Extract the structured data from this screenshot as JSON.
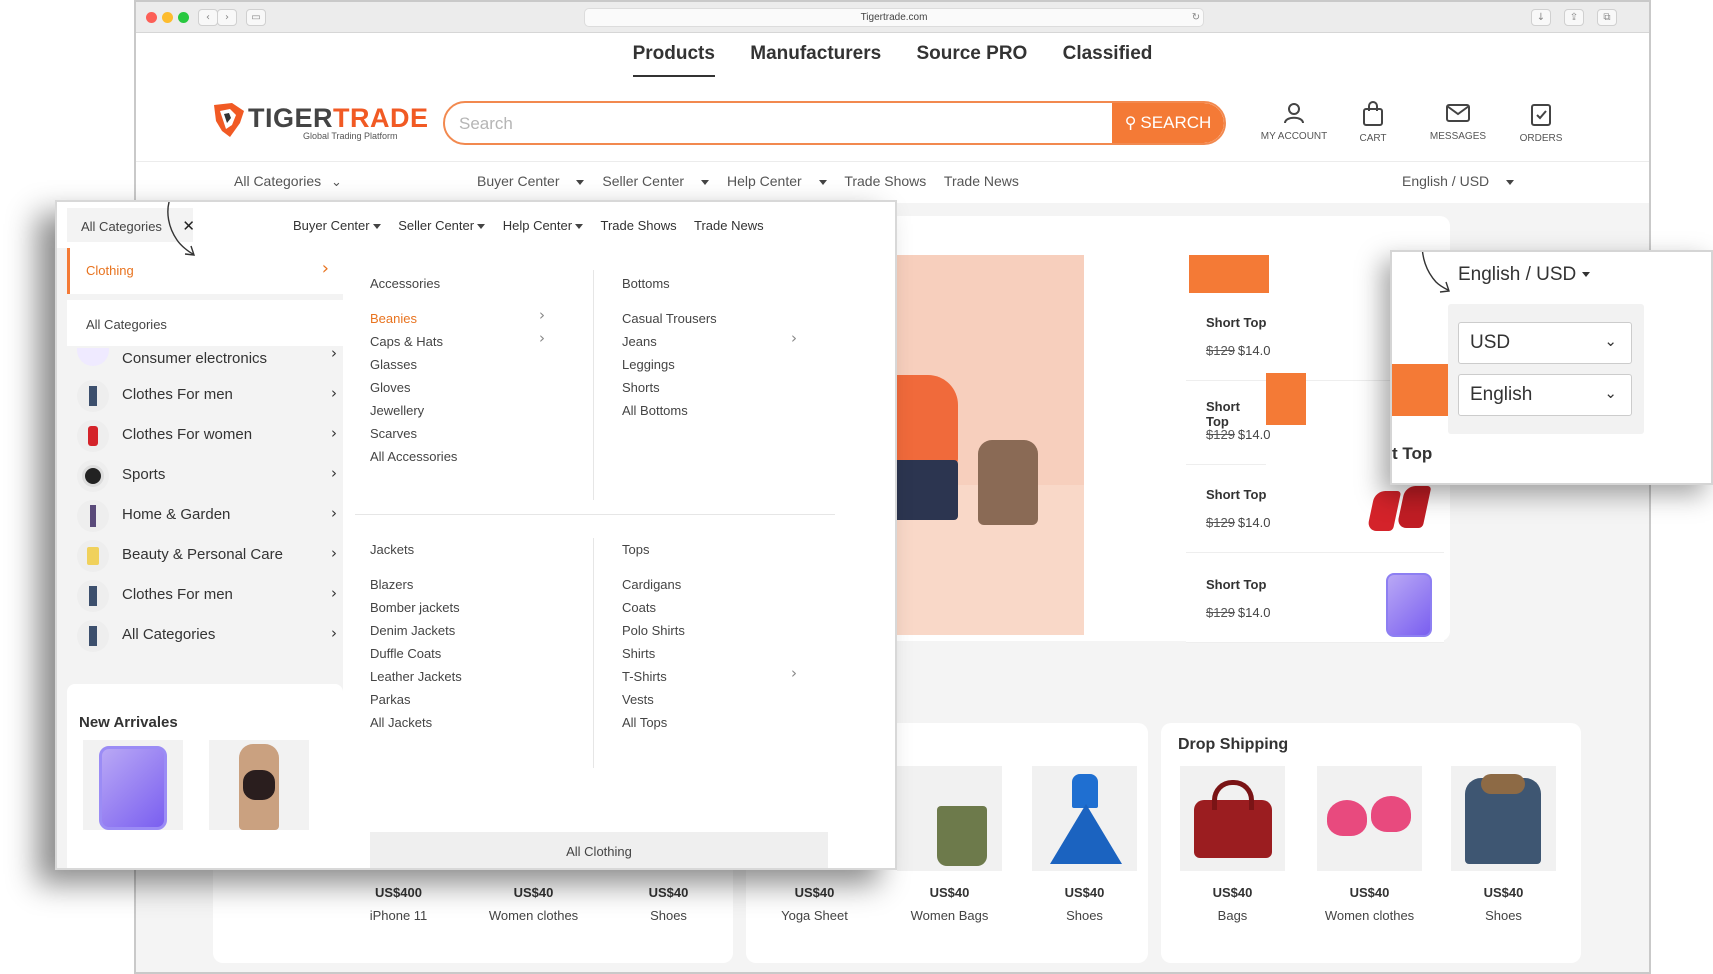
{
  "browser": {
    "url": "Tigertrade.com"
  },
  "topnav": {
    "items": [
      "Products",
      "Manufacturers",
      "Source PRO",
      "Classified"
    ]
  },
  "logo": {
    "name_a": "TIGER",
    "name_b": "TRADE",
    "tagline": "Global Trading Platform"
  },
  "search": {
    "placeholder": "Search",
    "button": "SEARCH"
  },
  "header_icons": {
    "account": "MY ACCOUNT",
    "cart": "CART",
    "messages": "MESSAGES",
    "orders": "ORDERS"
  },
  "subnav": {
    "all_categories": "All Categories",
    "buyer": "Buyer Center",
    "seller": "Seller Center",
    "help": "Help Center",
    "shows": "Trade Shows",
    "news": "Trade News",
    "lang": "English / USD"
  },
  "side_products": [
    {
      "title": "Short Top",
      "old": "$129",
      "new": "$14.0"
    },
    {
      "title": "Short Top",
      "old": "$129",
      "new": "$14.0"
    },
    {
      "title": "Short Top",
      "old": "$129",
      "new": "$14.0"
    },
    {
      "title": "Short Top",
      "old": "$129",
      "new": "$14.0"
    }
  ],
  "side_partial_title": "t Top",
  "drop_shipping": {
    "title": "Drop Shipping",
    "items": [
      {
        "price": "US$40",
        "name": "Bags"
      },
      {
        "price": "US$40",
        "name": "Women clothes"
      },
      {
        "price": "US$40",
        "name": "Shoes"
      }
    ]
  },
  "new_arrivals": {
    "title": "New Arrivales",
    "items": [
      {
        "price": "US$400",
        "name": "iPhone 11"
      },
      {
        "price": "US$40",
        "name": "Women clothes"
      },
      {
        "price": "US$40",
        "name": "Shoes"
      }
    ]
  },
  "middle_row": [
    {
      "price": "US$40",
      "name": "Yoga Sheet"
    },
    {
      "price": "US$40",
      "name": "Women Bags"
    },
    {
      "price": "US$40",
      "name": "Shoes"
    }
  ],
  "mega": {
    "all_categories": "All Categories",
    "close": "✕",
    "nav": [
      "Buyer Center",
      "Seller Center",
      "Help Center",
      "Trade Shows",
      "Trade News"
    ],
    "active": "Clothing",
    "all_cat_label": "All Categories",
    "categories": [
      "Consumer electronics",
      "Clothes For men",
      "Clothes For women",
      "Sports",
      "Home & Garden",
      "Beauty & Personal Care",
      "Clothes For men",
      "All Categories"
    ],
    "accessories": {
      "head": "Accessories",
      "items": [
        "Beanies",
        "Caps & Hats",
        "Glasses",
        "Gloves",
        "Jewellery",
        "Scarves",
        "All Accessories"
      ]
    },
    "bottoms": {
      "head": "Bottoms",
      "items": [
        "Casual Trousers",
        "Jeans",
        "Leggings",
        "Shorts",
        "All Bottoms"
      ]
    },
    "jackets": {
      "head": "Jackets",
      "items": [
        "Blazers",
        "Bomber jackets",
        "Denim Jackets",
        "Duffle Coats",
        "Leather Jackets",
        "Parkas",
        "All Jackets"
      ]
    },
    "tops": {
      "head": "Tops",
      "items": [
        "Cardigans",
        "Coats",
        "Polo Shirts",
        "Shirts",
        "T-Shirts",
        "Vests",
        "All Tops"
      ]
    },
    "all_clothing": "All Clothing"
  },
  "lang_popup": {
    "title": "English / USD",
    "currency": "USD",
    "language": "English"
  },
  "colors": {
    "accent": "#f47a36",
    "active_text": "#e8731f"
  }
}
